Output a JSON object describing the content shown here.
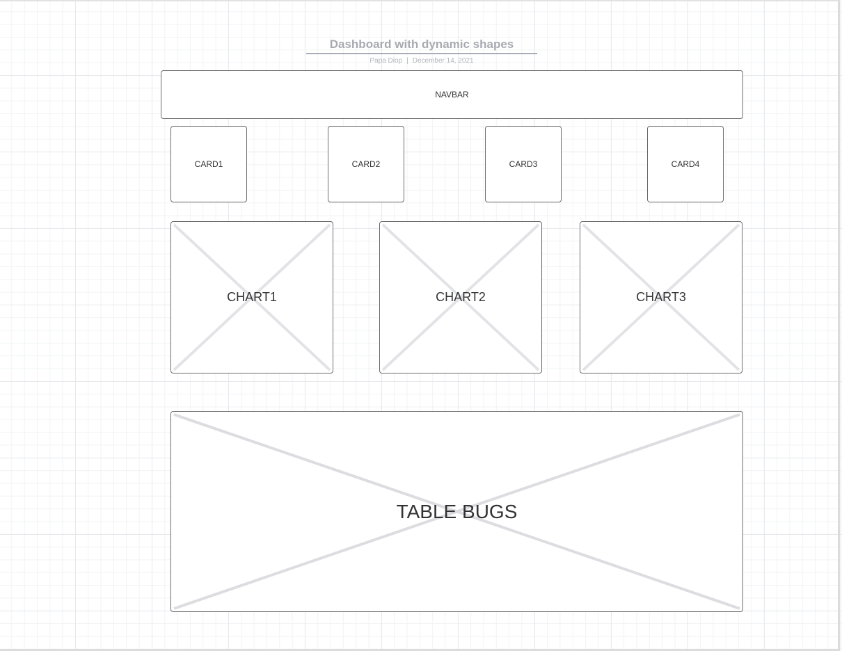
{
  "title": "Dashboard with dynamic shapes",
  "subtitle": {
    "author": "Papa Diop",
    "separator": "|",
    "date": "December 14, 2021"
  },
  "navbar": {
    "label": "NAVBAR"
  },
  "cards": [
    {
      "label": "CARD1"
    },
    {
      "label": "CARD2"
    },
    {
      "label": "CARD3"
    },
    {
      "label": "CARD4"
    }
  ],
  "charts": [
    {
      "label": "CHART1"
    },
    {
      "label": "CHART2"
    },
    {
      "label": "CHART3"
    }
  ],
  "table": {
    "label": "TABLE BUGS"
  },
  "colors": {
    "background": "#ffffff",
    "grid_major": "#e7e9ed",
    "grid_minor": "#f2f3f5",
    "shape_border": "#6b6b6b",
    "placeholder_cross": "#e2e3e6",
    "title_text": "#a7aab0",
    "label_text": "#333333"
  },
  "icons": {
    "placeholder": "image-placeholder-cross-icon"
  }
}
